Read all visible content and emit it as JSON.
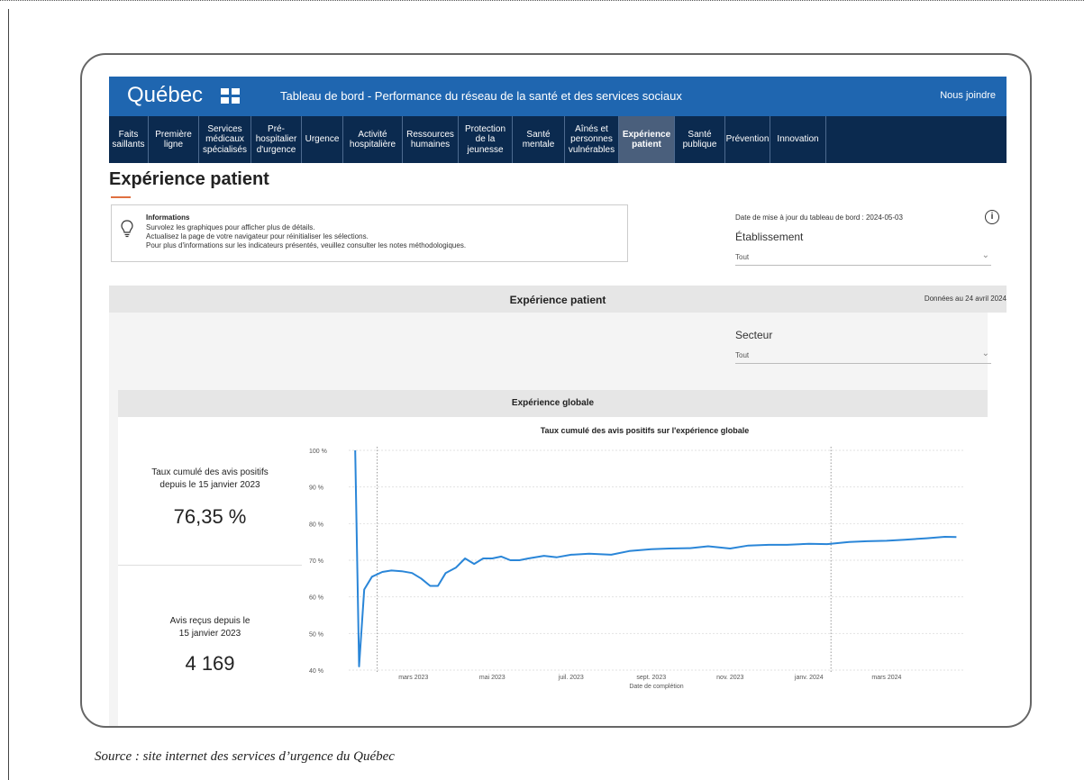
{
  "header": {
    "logo_text": "Québec",
    "title": "Tableau de bord - Performance du réseau de la santé et des services sociaux",
    "contact_link": "Nous joindre"
  },
  "nav": {
    "items": [
      {
        "label": "Faits\nsaillants"
      },
      {
        "label": "Première\nligne"
      },
      {
        "label": "Services\nmédicaux\nspécialisés"
      },
      {
        "label": "Pré-\nhospitalier\nd'urgence"
      },
      {
        "label": "Urgence"
      },
      {
        "label": "Activité\nhospitalière"
      },
      {
        "label": "Ressources\nhumaines"
      },
      {
        "label": "Protection\nde la\njeunesse"
      },
      {
        "label": "Santé\nmentale"
      },
      {
        "label": "Aînés et\npersonnes\nvulnérables"
      },
      {
        "label": "Expérience\npatient",
        "active": true
      },
      {
        "label": "Santé\npublique"
      },
      {
        "label": "Prévention"
      },
      {
        "label": "Innovation"
      }
    ]
  },
  "page": {
    "title": "Expérience patient"
  },
  "info": {
    "title": "Informations",
    "lines": [
      "Survolez les graphiques pour afficher plus de détails.",
      "Actualisez la page de votre navigateur pour réinitialiser les sélections.",
      "Pour plus d'informations sur les indicateurs présentés, veuillez consulter les notes méthodologiques."
    ]
  },
  "filters": {
    "updated_text": "Date de mise à jour du tableau de bord : 2024-05-03",
    "etablissement_label": "Établissement",
    "etablissement_value": "Tout",
    "secteur_label": "Secteur",
    "secteur_value": "Tout"
  },
  "section": {
    "title": "Expérience patient",
    "date": "Données au 24 avril 2024",
    "subsection_title": "Expérience globale"
  },
  "kpis": {
    "rate_label_1": "Taux cumulé des avis positifs",
    "rate_label_2": "depuis le 15 janvier 2023",
    "rate_value": "76,35 %",
    "count_label_1": "Avis reçus depuis le",
    "count_label_2": "15 janvier 2023",
    "count_value": "4 169"
  },
  "colors": {
    "header_blue": "#1f66b0",
    "nav_navy": "#0b2a4f",
    "nav_active": "#4a5f7c",
    "line_blue": "#2a86d8",
    "accent_orange": "#e07040"
  },
  "chart_data": {
    "type": "line",
    "title": "Taux cumulé des avis positifs sur l'expérience globale",
    "xlabel": "Date de complétion",
    "ylabel": "",
    "ylim": [
      40,
      100
    ],
    "y_ticks": [
      "100 %",
      "90 %",
      "80 %",
      "70 %",
      "60 %",
      "50 %",
      "40 %"
    ],
    "x_ticks": [
      "mars 2023",
      "mai 2023",
      "juil. 2023",
      "sept. 2023",
      "nov. 2023",
      "janv. 2024",
      "mars 2024"
    ],
    "series": [
      {
        "x": [
          "2023-01-15",
          "2023-01-18",
          "2023-01-22",
          "2023-01-28",
          "2023-02-05",
          "2023-02-12",
          "2023-02-20",
          "2023-02-28",
          "2023-03-07",
          "2023-03-14",
          "2023-03-20",
          "2023-03-26",
          "2023-04-03",
          "2023-04-10",
          "2023-04-17",
          "2023-04-24",
          "2023-05-01",
          "2023-05-08",
          "2023-05-15",
          "2023-05-22",
          "2023-05-29",
          "2023-06-10",
          "2023-06-20",
          "2023-07-01",
          "2023-07-15",
          "2023-08-01",
          "2023-08-15",
          "2023-09-01",
          "2023-09-15",
          "2023-10-01",
          "2023-10-15",
          "2023-11-01",
          "2023-11-15",
          "2023-12-01",
          "2023-12-15",
          "2024-01-01",
          "2024-01-15",
          "2024-02-01",
          "2024-02-15",
          "2024-03-01",
          "2024-03-15",
          "2024-04-01",
          "2024-04-15",
          "2024-04-24"
        ],
        "values": [
          100,
          41,
          62,
          65.5,
          66.8,
          67.2,
          67,
          66.5,
          65,
          63,
          63,
          66.5,
          68,
          70.5,
          69,
          70.5,
          70.5,
          71,
          70,
          70,
          70.5,
          71.2,
          70.8,
          71.5,
          71.8,
          71.5,
          72.5,
          73,
          73.2,
          73.3,
          73.8,
          73.2,
          74,
          74.2,
          74.2,
          74.5,
          74.4,
          75,
          75.2,
          75.3,
          75.6,
          76,
          76.4,
          76.35
        ]
      }
    ]
  },
  "source_caption": "Source : site internet des services d’urgence du Québec"
}
